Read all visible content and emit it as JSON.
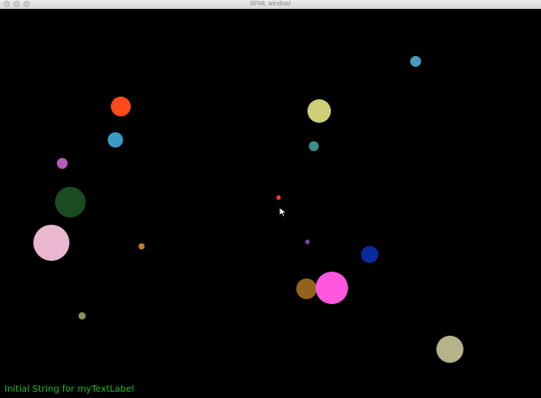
{
  "window": {
    "title": "SFML window!"
  },
  "canvas": {
    "background": "#000000"
  },
  "text_label": {
    "text": "Initial String for myTextLabel",
    "color": "#19c020"
  },
  "circle_colors": [
    "#ff4a1a",
    "#3b9bc7",
    "#b85bbd",
    "#1b4b21",
    "#e9b8d0",
    "#c27b28",
    "#8d8d55",
    "#4a9ac2",
    "#cfcf79",
    "#3c8e8c",
    "#ff3b2e",
    "#7c45b6",
    "#0a2aa0",
    "#93631c",
    "#ff58df",
    "#b6b28a"
  ],
  "cursor_icon": "arrow-cursor-icon"
}
